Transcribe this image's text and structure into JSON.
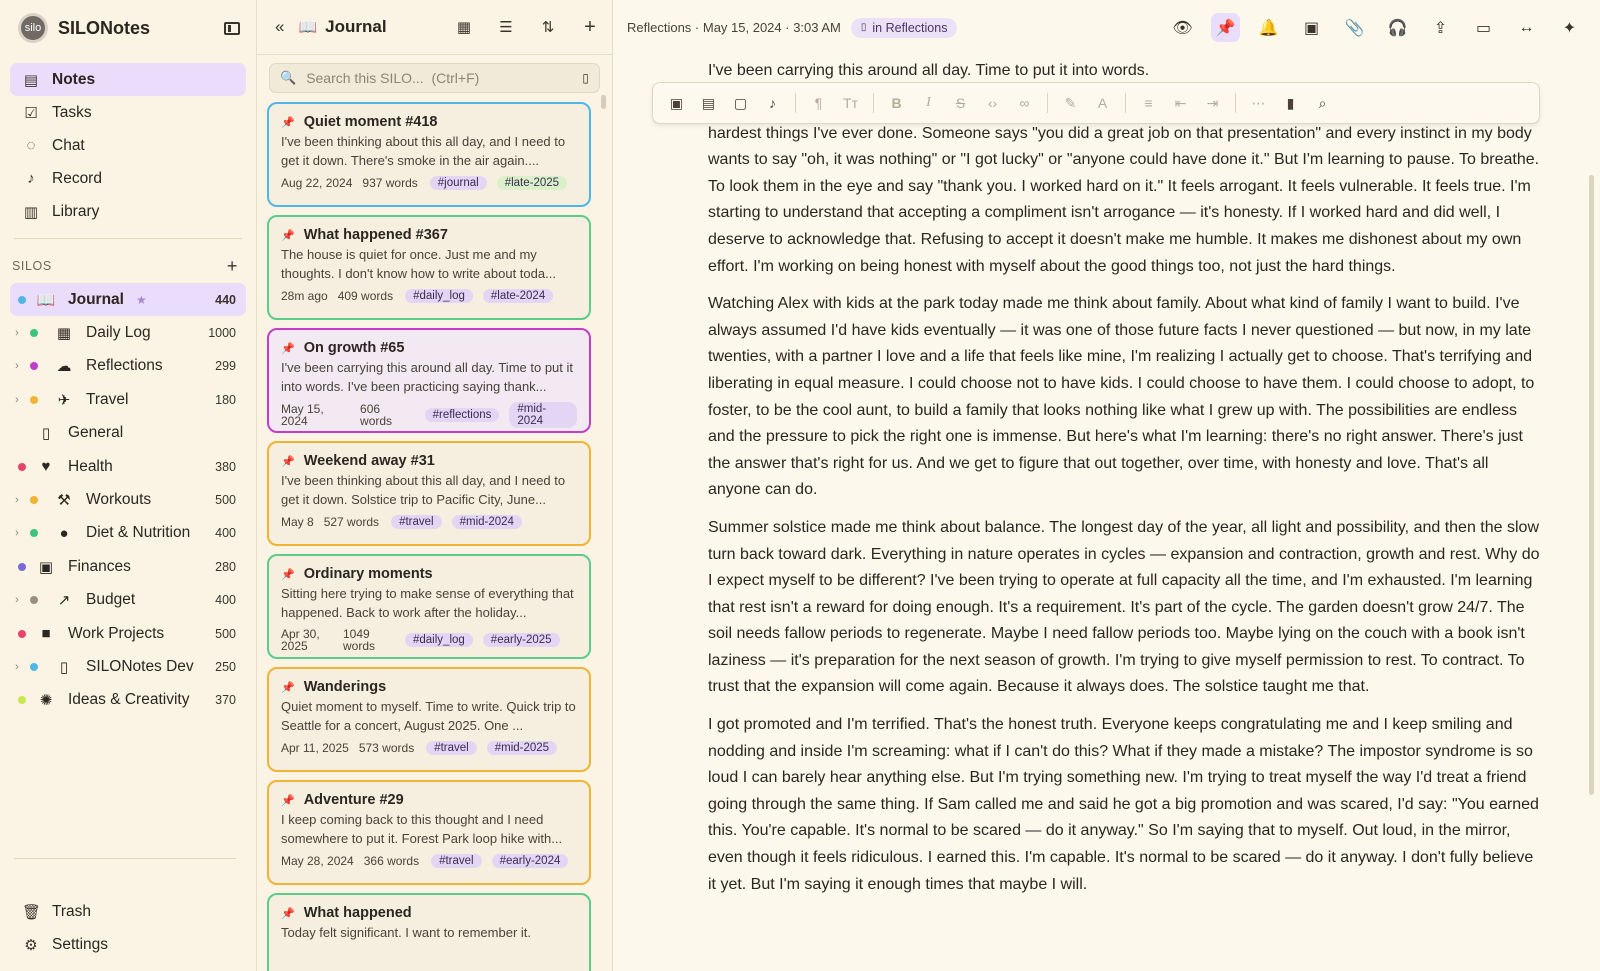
{
  "brand": {
    "name": "SILONotes",
    "logo_text": "silo"
  },
  "nav": [
    {
      "label": "Notes",
      "icon": "notes-icon",
      "glyph": "▤",
      "active": true
    },
    {
      "label": "Tasks",
      "icon": "tasks-icon",
      "glyph": "☑",
      "active": false
    },
    {
      "label": "Chat",
      "icon": "chat-icon",
      "glyph": "◌",
      "active": false
    },
    {
      "label": "Record",
      "icon": "microphone-icon",
      "glyph": "♪",
      "active": false
    },
    {
      "label": "Library",
      "icon": "library-icon",
      "glyph": "▥",
      "active": false
    }
  ],
  "silos_header": "SILOS",
  "silos": [
    {
      "label": "Journal",
      "count": "440",
      "color": "#4fb6e8",
      "glyph": "📖",
      "icon": "book-icon",
      "active": true,
      "star": "★",
      "sub": false,
      "chevron": false
    },
    {
      "label": "Daily Log",
      "count": "1000",
      "color": "#3ec47a",
      "glyph": "▦",
      "icon": "calendar-icon",
      "active": false,
      "sub": true,
      "chevron": true
    },
    {
      "label": "Reflections",
      "count": "299",
      "color": "#c23ec9",
      "glyph": "☁",
      "icon": "thought-bubble-icon",
      "active": false,
      "sub": true,
      "chevron": true
    },
    {
      "label": "Travel",
      "count": "180",
      "color": "#f2b233",
      "glyph": "✈",
      "icon": "airplane-icon",
      "active": false,
      "sub": true,
      "chevron": true
    },
    {
      "label": "General",
      "count": "",
      "color": "",
      "glyph": "▯",
      "icon": "notebook-icon",
      "active": false,
      "sub": false,
      "chevron": false,
      "nodot": true
    },
    {
      "label": "Health",
      "count": "380",
      "color": "#e8436a",
      "glyph": "♥",
      "icon": "heart-pulse-icon",
      "active": false,
      "sub": false,
      "chevron": false
    },
    {
      "label": "Workouts",
      "count": "500",
      "color": "#f2b233",
      "glyph": "⚒",
      "icon": "dumbbell-icon",
      "active": false,
      "sub": true,
      "chevron": true
    },
    {
      "label": "Diet & Nutrition",
      "count": "400",
      "color": "#3ec47a",
      "glyph": "●",
      "icon": "apple-icon",
      "active": false,
      "sub": true,
      "chevron": true
    },
    {
      "label": "Finances",
      "count": "280",
      "color": "#7a6ad8",
      "glyph": "▣",
      "icon": "cash-icon",
      "active": false,
      "sub": false,
      "chevron": false
    },
    {
      "label": "Budget",
      "count": "400",
      "color": "#9a8f82",
      "glyph": "↗",
      "icon": "chart-line-icon",
      "active": false,
      "sub": true,
      "chevron": true
    },
    {
      "label": "Work Projects",
      "count": "500",
      "color": "#e8436a",
      "glyph": "■",
      "icon": "briefcase-icon",
      "active": false,
      "sub": false,
      "chevron": false
    },
    {
      "label": "SILONotes Dev",
      "count": "250",
      "color": "#4fb6e8",
      "glyph": "▯",
      "icon": "phone-icon",
      "active": false,
      "sub": true,
      "chevron": true
    },
    {
      "label": "Ideas & Creativity",
      "count": "370",
      "color": "#c9e84f",
      "glyph": "✺",
      "icon": "lightbulb-icon",
      "active": false,
      "sub": false,
      "chevron": false
    }
  ],
  "bottom_nav": [
    {
      "label": "Trash",
      "icon": "trash-icon",
      "glyph": "🗑"
    },
    {
      "label": "Settings",
      "icon": "gear-icon",
      "glyph": "⚙"
    }
  ],
  "list": {
    "title": "Journal",
    "search_placeholder": "Search this SILO...  (Ctrl+F)",
    "cards": [
      {
        "title": "Quiet moment #418",
        "excerpt": "I've been thinking about this all day, and I need to get it down. There's smoke in the air again....",
        "date": "Aug 22, 2024",
        "words": "937 words",
        "tags": [
          "#journal",
          "#late-2025"
        ],
        "border": "#4fb6e8",
        "tagcolor": "#e3d6f4",
        "tag2color": "#d9f0c9"
      },
      {
        "title": "What happened #367",
        "excerpt": "The house is quiet for once. Just me and my thoughts. I don't know how to write about toda...",
        "date": "28m ago",
        "words": "409 words",
        "tags": [
          "#daily_log",
          "#late-2024"
        ],
        "border": "#5ccc8a",
        "tagcolor": "#e3d6f4",
        "tag2color": "#e3d6f4"
      },
      {
        "title": "On growth #65",
        "excerpt": "I've been carrying this around all day. Time to put it into words. I've been practicing saying thank...",
        "date": "May 15, 2024",
        "words": "606 words",
        "tags": [
          "#reflections",
          "#mid-2024"
        ],
        "border": "#c23ec9",
        "tagcolor": "#e3d6f4",
        "tag2color": "#e3d6f4",
        "highlight": true
      },
      {
        "title": "Weekend away #31",
        "excerpt": "I've been thinking about this all day, and I need to get it down. Solstice trip to Pacific City, June...",
        "date": "May 8",
        "words": "527 words",
        "tags": [
          "#travel",
          "#mid-2024"
        ],
        "border": "#f2b233",
        "tagcolor": "#e3d6f4",
        "tag2color": "#e3d6f4"
      },
      {
        "title": "Ordinary moments",
        "excerpt": "Sitting here trying to make sense of everything that happened. Back to work after the holiday...",
        "date": "Apr 30, 2025",
        "words": "1049 words",
        "tags": [
          "#daily_log",
          "#early-2025"
        ],
        "border": "#5ccc8a",
        "tagcolor": "#e3d6f4",
        "tag2color": "#e3d6f4"
      },
      {
        "title": "Wanderings",
        "excerpt": "Quiet moment to myself. Time to write. Quick trip to Seattle for a concert, August 2025. One ...",
        "date": "Apr 11, 2025",
        "words": "573 words",
        "tags": [
          "#travel",
          "#mid-2025"
        ],
        "border": "#f2b233",
        "tagcolor": "#e3d6f4",
        "tag2color": "#e3d6f4"
      },
      {
        "title": "Adventure #29",
        "excerpt": "I keep coming back to this thought and I need somewhere to put it. Forest Park loop hike with...",
        "date": "May 28, 2024",
        "words": "366 words",
        "tags": [
          "#travel",
          "#early-2024"
        ],
        "border": "#f2b233",
        "tagcolor": "#e3d6f4",
        "tag2color": "#e3d6f4"
      },
      {
        "title": "What happened",
        "excerpt": "Today felt significant. I want to remember it.",
        "date": "",
        "words": "",
        "tags": [],
        "border": "#5ccc8a",
        "tagcolor": "#e3d6f4",
        "tag2color": "#e3d6f4"
      }
    ]
  },
  "editor": {
    "breadcrumb": "Reflections · May 15, 2024 · 3:03 AM",
    "in_silo": "in Reflections",
    "header_icons": [
      "eye-icon",
      "pin-icon",
      "bell-icon",
      "image-add-icon",
      "paperclip-icon",
      "headphones-icon",
      "share-icon",
      "folder-move-icon",
      "fit-width-icon",
      "sparkle-icon"
    ],
    "header_glyphs": [
      "👁",
      "📌",
      "🔔",
      "▣",
      "📎",
      "🎧",
      "⇪",
      "▭",
      "↔",
      "✦"
    ],
    "first_line": "I've been carrying this around all day. Time to put it into words.",
    "paragraphs": [
      "hardest things I've ever done. Someone says \"you did a great job on that presentation\" and every instinct in my body wants to say \"oh, it was nothing\" or \"I got lucky\" or \"anyone could have done it.\" But I'm learning to pause. To breathe. To look them in the eye and say \"thank you. I worked hard on it.\" It feels arrogant. It feels vulnerable. It feels true. I'm starting to understand that accepting a compliment isn't arrogance — it's honesty. If I worked hard and did well, I deserve to acknowledge that. Refusing to accept it doesn't make me humble. It makes me dishonest about my own effort. I'm working on being honest with myself about the good things too, not just the hard things.",
      "Watching Alex with kids at the park today made me think about family. About what kind of family I want to build. I've always assumed I'd have kids eventually — it was one of those future facts I never questioned — but now, in my late twenties, with a partner I love and a life that feels like mine, I'm realizing I actually get to choose. That's terrifying and liberating in equal measure. I could choose not to have kids. I could choose to have them. I could choose to adopt, to foster, to be the cool aunt, to build a family that looks nothing like what I grew up with. The possibilities are endless and the pressure to pick the right one is immense. But here's what I'm learning: there's no right answer. There's just the answer that's right for us. And we get to figure that out together, over time, with honesty and love. That's all anyone can do.",
      "Summer solstice made me think about balance. The longest day of the year, all light and possibility, and then the slow turn back toward dark. Everything in nature operates in cycles — expansion and contraction, growth and rest. Why do I expect myself to be different? I've been trying to operate at full capacity all the time, and I'm exhausted. I'm learning that rest isn't a reward for doing enough. It's a requirement. It's part of the cycle. The garden doesn't grow 24/7. The soil needs fallow periods to regenerate. Maybe I need fallow periods too. Maybe lying on the couch with a book isn't laziness — it's preparation for the next season of growth. I'm trying to give myself permission to rest. To contract. To trust that the expansion will come again. Because it always does. The solstice taught me that.",
      "I got promoted and I'm terrified. That's the honest truth. Everyone keeps congratulating me and I keep smiling and nodding and inside I'm screaming: what if I can't do this? What if they made a mistake? The impostor syndrome is so loud I can barely hear anything else. But I'm trying something new. I'm trying to treat myself the way I'd treat a friend going through the same thing. If Sam called me and said he got a big promotion and was scared, I'd say: \"You earned this. You're capable. It's normal to be scared — do it anyway.\" So I'm saying that to myself. Out loud, in the mirror, even though it feels ridiculous. I earned this. I'm capable. It's normal to be scared — do it anyway. I don't fully believe it yet. But I'm saying it enough times that maybe I will."
    ]
  }
}
